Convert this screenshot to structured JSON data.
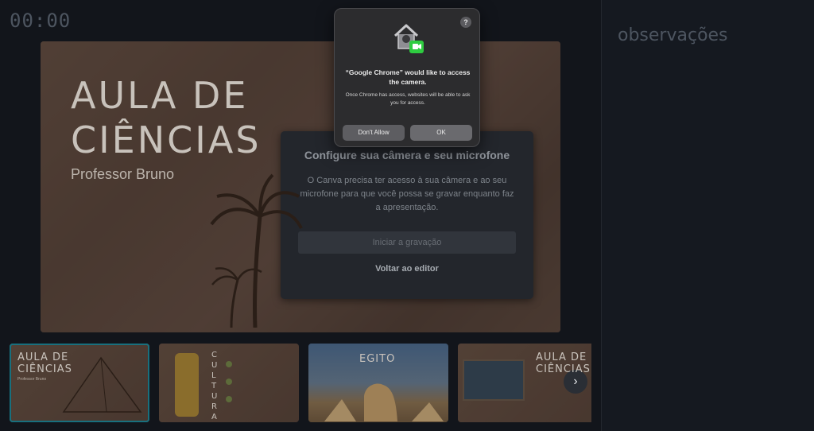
{
  "presenter": {
    "timer": "00:00",
    "notes_title": "observações"
  },
  "slide": {
    "title_line1": "AULA DE",
    "title_line2": "CIÊNCIAS",
    "subtitle": "Professor Bruno"
  },
  "thumbnails": [
    {
      "title_line1": "AULA DE",
      "title_line2": "CIÊNCIAS",
      "caption": "Professor Bruno",
      "active": true
    },
    {
      "vertical_word": "CULTURA"
    },
    {
      "title": "EGITO"
    },
    {
      "title_line1": "AULA DE",
      "title_line2": "CIÊNCIAS"
    }
  ],
  "next_button": {
    "icon": "chevron-right-icon",
    "glyph": "›"
  },
  "record_dialog": {
    "title": "Configure sua câmera e seu microfone",
    "body": "O Canva precisa ter acesso à sua câmera e ao seu microfone para que você possa se gravar enquanto faz a apresentação.",
    "start_button": "Iniciar a gravação",
    "back_link": "Voltar ao editor"
  },
  "permission_dialog": {
    "help": "?",
    "title": "“Google Chrome” would like to access the camera.",
    "body": "Once Chrome has access, websites will be able to ask you for access.",
    "deny_button": "Don't Allow",
    "ok_button": "OK",
    "icon": "home-camera-icon"
  },
  "colors": {
    "accent": "#21a7b8",
    "facetime_green": "#2ecc40"
  }
}
